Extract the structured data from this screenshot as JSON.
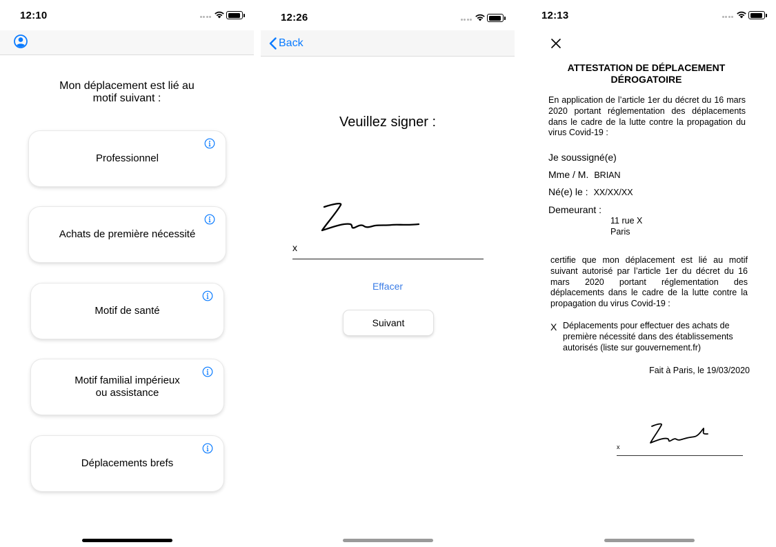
{
  "screen1": {
    "status_time": "12:10",
    "title_line1": "Mon déplacement est lié au",
    "title_line2": "motif suivant :",
    "motifs": [
      {
        "line1": "Professionnel",
        "line2": ""
      },
      {
        "line1": "Achats de première nécessité",
        "line2": ""
      },
      {
        "line1": "Motif de santé",
        "line2": ""
      },
      {
        "line1": "Motif familial impérieux",
        "line2": "ou assistance"
      },
      {
        "line1": "Déplacements brefs",
        "line2": ""
      }
    ],
    "icons": {
      "profile": "person-circle-icon",
      "info": "info-circle-icon"
    }
  },
  "screen2": {
    "status_time": "12:26",
    "back_label": "Back",
    "title": "Veuillez signer :",
    "sign_x": "x",
    "clear_label": "Effacer",
    "next_label": "Suivant",
    "icons": {
      "back": "chevron-left-icon"
    }
  },
  "screen3": {
    "status_time": "12:13",
    "doc_title_line1": "ATTESTATION DE DÉPLACEMENT",
    "doc_title_line2": "DÉROGATOIRE",
    "intro": "En application de l’article 1er du décret du 16 mars 2020 portant réglementation des déplacements dans le cadre de la lutte contre la propagation du virus Covid-19 :",
    "undersigned": "Je soussigné(e)",
    "name_label": "Mme / M.",
    "name_value": "BRIAN",
    "birth_label": "Né(e) le :",
    "birth_value": "XX/XX/XX",
    "address_label": "Demeurant :",
    "address_line1": "11 rue X",
    "address_line2": "Paris",
    "certifies": "certifie que mon déplacement est lié au motif suivant autorisé par l’article 1er du décret du 16 mars 2020 portant réglementation des déplacements dans le cadre de la lutte contre la propagation du virus Covid-19 :",
    "reason_mark": "X",
    "reason": "Déplacements pour effectuer des achats de première nécessité dans des établissements autorisés (liste sur gouvernement.fr)",
    "signed_at": "Fait à Paris, le 19/03/2020",
    "sign_x": "x",
    "icons": {
      "close": "close-icon"
    }
  },
  "colors": {
    "accent": "#0a7bff",
    "link": "#3a7ce6"
  }
}
